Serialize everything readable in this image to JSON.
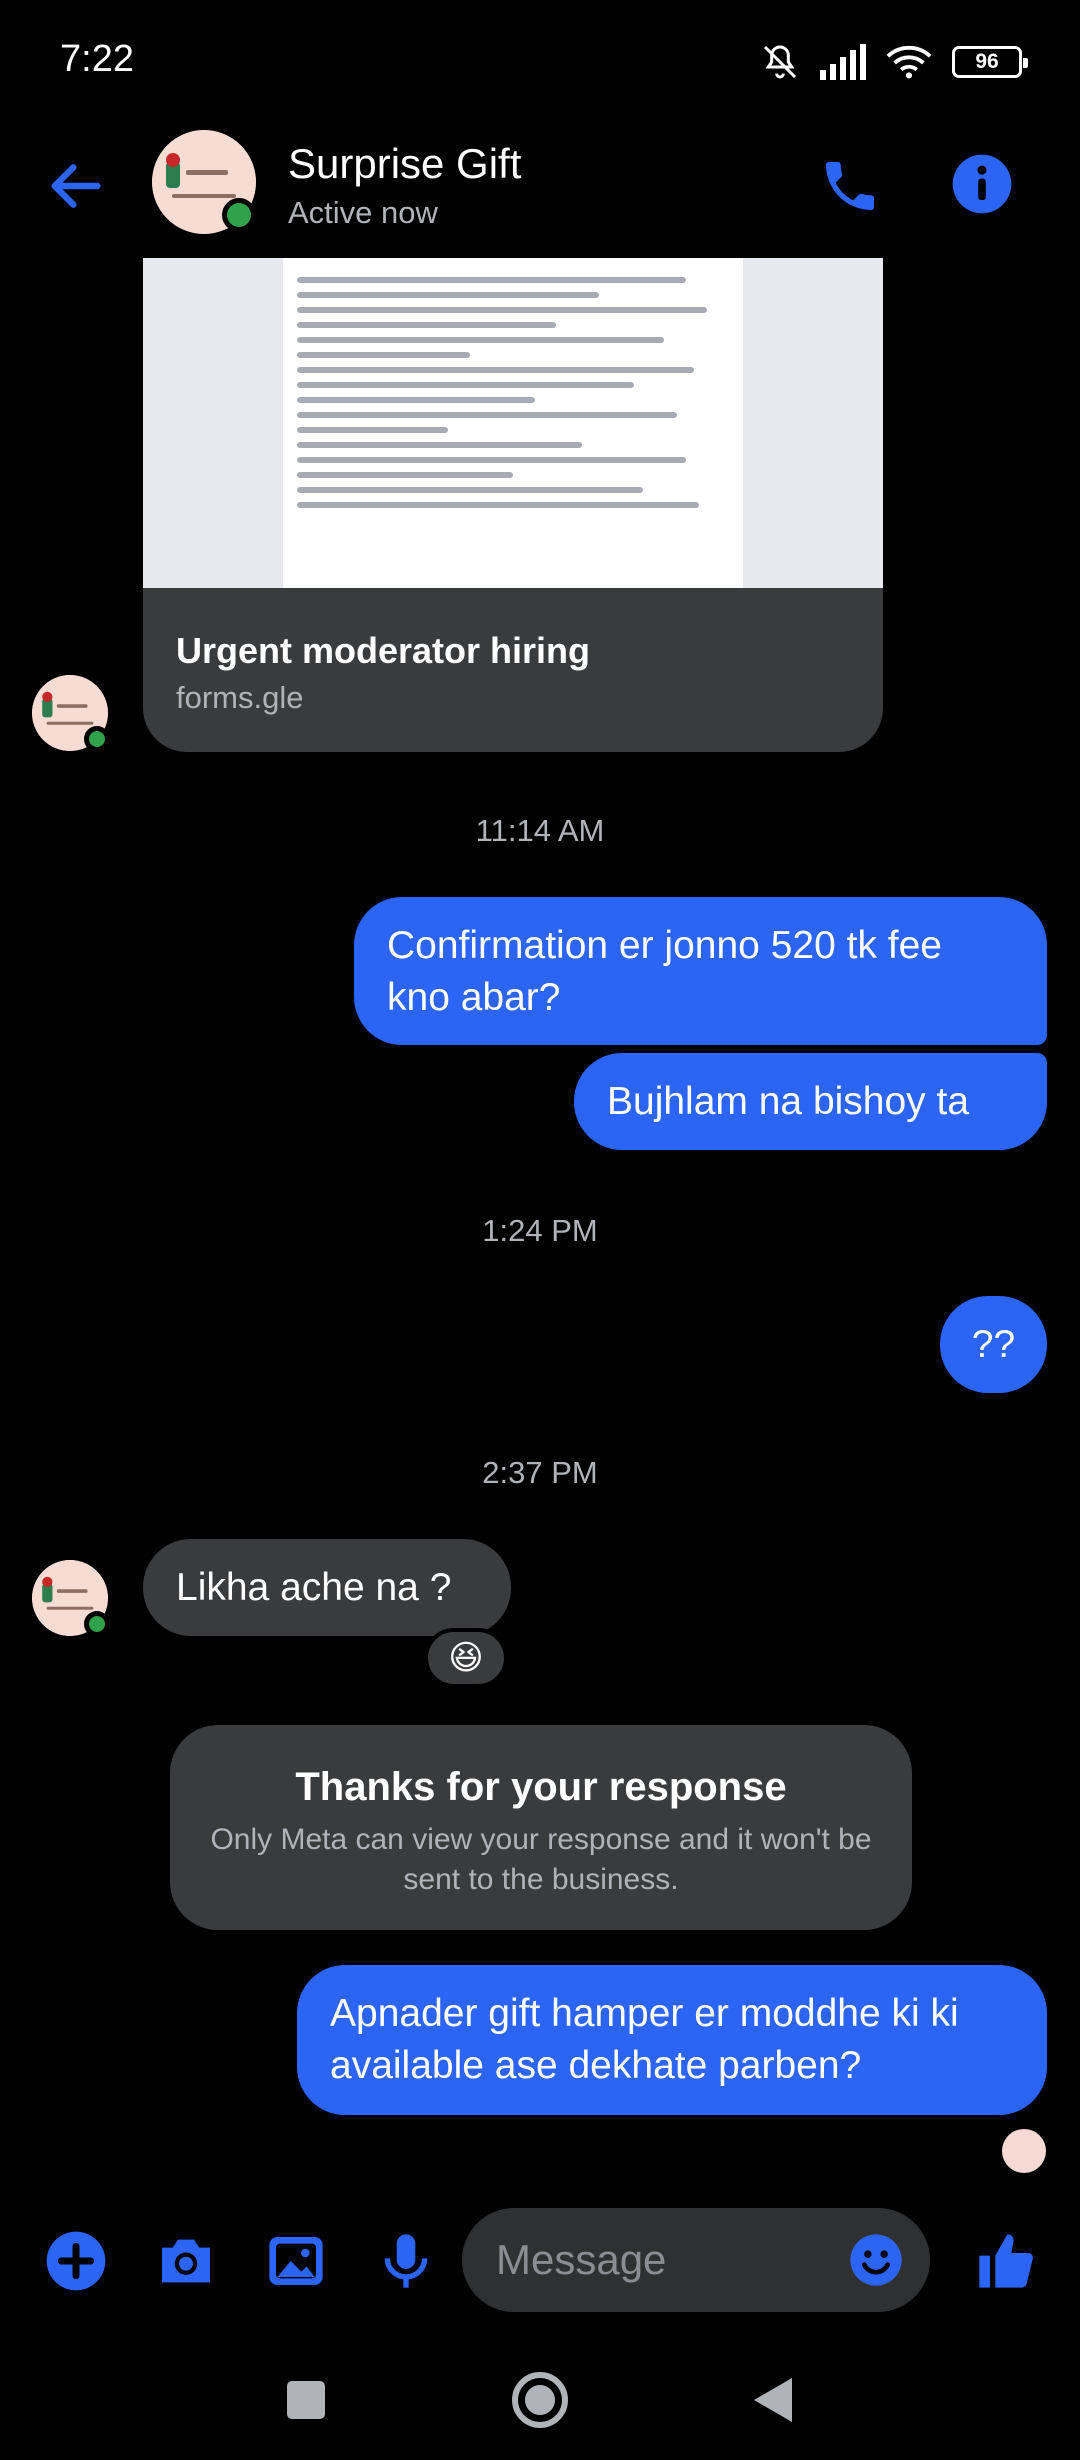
{
  "status_bar": {
    "time": "7:22",
    "battery": "96"
  },
  "header": {
    "title": "Surprise Gift",
    "subtitle": "Active now"
  },
  "link_card": {
    "title": "Urgent moderator hiring",
    "domain": "forms.gle"
  },
  "messages": {
    "ts_1": "11:14 AM",
    "out_1": "Confirmation er jonno 520 tk fee kno abar?",
    "out_2": "Bujhlam na bishoy ta",
    "ts_2": "1:24 PM",
    "out_3": "??",
    "ts_3": "2:37 PM",
    "in_1": "Likha ache na ?",
    "in_1_reaction": "😆",
    "notice_title": "Thanks for your response",
    "notice_body": "Only Meta can view your response and it won't be sent to the business.",
    "out_4": "Apnader gift hamper er moddhe ki ki available ase dekhate parben?"
  },
  "composer": {
    "placeholder": "Message"
  },
  "colors": {
    "accent": "#2c64f6",
    "bubble_in": "#3a3b3c",
    "online": "#31a24c"
  },
  "icons": [
    "back-arrow-icon",
    "phone-icon",
    "info-icon",
    "plus-icon",
    "camera-icon",
    "gallery-icon",
    "microphone-icon",
    "emoji-icon",
    "thumbs-up-icon",
    "nav-square-icon",
    "nav-home-icon",
    "nav-back-icon"
  ]
}
